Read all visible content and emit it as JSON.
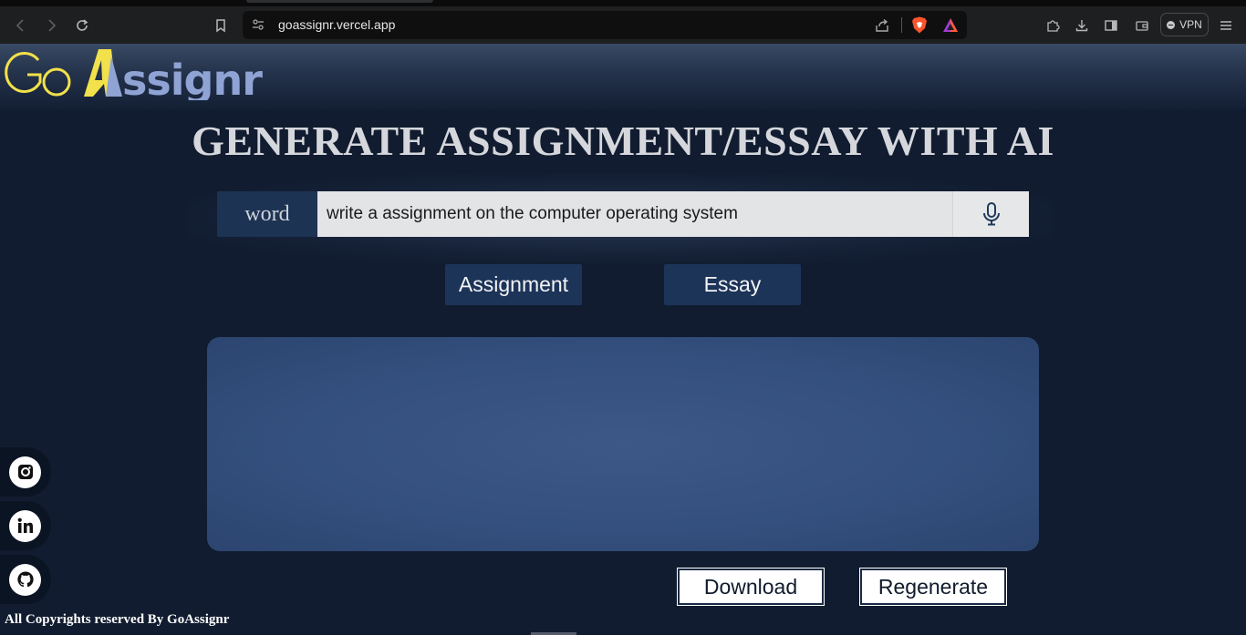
{
  "browser": {
    "url": "goassignr.vercel.app",
    "vpn_label": "VPN"
  },
  "site": {
    "logo_text": "GoAssignr",
    "logo_colors": {
      "go": "#f2e14a",
      "a": "#f2e14a",
      "ssignr": "#8fa3d4"
    },
    "title": "GENERATE ASSIGNMENT/ESSAY WITH AI"
  },
  "prompt": {
    "label": "word",
    "value": "write a assignment on the computer operating system",
    "mic_icon": "microphone-icon"
  },
  "buttons": {
    "assignment": "Assignment",
    "essay": "Essay",
    "download": "Download",
    "regenerate": "Regenerate"
  },
  "social": [
    {
      "name": "instagram-icon"
    },
    {
      "name": "linkedin-icon"
    },
    {
      "name": "github-icon"
    }
  ],
  "footer": {
    "copyright": "All Copyrights reserved By GoAssignr"
  }
}
